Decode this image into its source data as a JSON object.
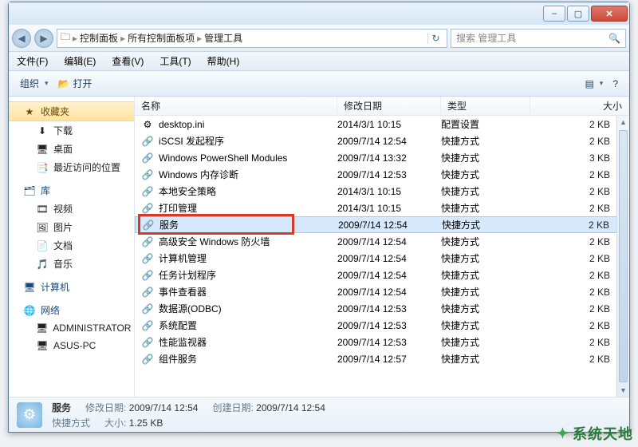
{
  "titlebar": {
    "min": "–",
    "max": "▢",
    "close": "✕"
  },
  "nav": {
    "back": "◀",
    "fwd": "▶",
    "crumbs": [
      "控制面板",
      "所有控制面板项",
      "管理工具"
    ],
    "refresh": "↻",
    "search_placeholder": "搜索 管理工具"
  },
  "menu": [
    "文件(F)",
    "编辑(E)",
    "查看(V)",
    "工具(T)",
    "帮助(H)"
  ],
  "toolbar": {
    "organize": "组织",
    "open": "打开",
    "view_icon": "▤",
    "help_icon": "?"
  },
  "sidebar": {
    "favorites": {
      "label": "收藏夹",
      "icon": "★",
      "items": [
        {
          "icon": "⬇",
          "label": "下载"
        },
        {
          "icon": "🖥",
          "label": "桌面"
        },
        {
          "icon": "📑",
          "label": "最近访问的位置"
        }
      ]
    },
    "libraries": {
      "label": "库",
      "icon": "🗂",
      "items": [
        {
          "icon": "🎞",
          "label": "视频"
        },
        {
          "icon": "🖼",
          "label": "图片"
        },
        {
          "icon": "📄",
          "label": "文档"
        },
        {
          "icon": "🎵",
          "label": "音乐"
        }
      ]
    },
    "computer": {
      "label": "计算机",
      "icon": "🖥",
      "items": []
    },
    "network": {
      "label": "网络",
      "icon": "🌐",
      "items": [
        {
          "icon": "🖥",
          "label": "ADMINISTRATOR"
        },
        {
          "icon": "🖥",
          "label": "ASUS-PC"
        }
      ]
    }
  },
  "columns": {
    "name": "名称",
    "date": "修改日期",
    "type": "类型",
    "size": "大小"
  },
  "files": [
    {
      "icon": "⚙",
      "name": "desktop.ini",
      "date": "2014/3/1 10:15",
      "type": "配置设置",
      "size": "2 KB"
    },
    {
      "icon": "🔗",
      "name": "iSCSI 发起程序",
      "date": "2009/7/14 12:54",
      "type": "快捷方式",
      "size": "2 KB"
    },
    {
      "icon": "🔗",
      "name": "Windows PowerShell Modules",
      "date": "2009/7/14 13:32",
      "type": "快捷方式",
      "size": "3 KB"
    },
    {
      "icon": "🔗",
      "name": "Windows 内存诊断",
      "date": "2009/7/14 12:53",
      "type": "快捷方式",
      "size": "2 KB"
    },
    {
      "icon": "🔗",
      "name": "本地安全策略",
      "date": "2014/3/1 10:15",
      "type": "快捷方式",
      "size": "2 KB"
    },
    {
      "icon": "🔗",
      "name": "打印管理",
      "date": "2014/3/1 10:15",
      "type": "快捷方式",
      "size": "2 KB"
    },
    {
      "icon": "🔗",
      "name": "服务",
      "date": "2009/7/14 12:54",
      "type": "快捷方式",
      "size": "2 KB",
      "selected": true
    },
    {
      "icon": "🔗",
      "name": "高级安全 Windows 防火墙",
      "date": "2009/7/14 12:54",
      "type": "快捷方式",
      "size": "2 KB"
    },
    {
      "icon": "🔗",
      "name": "计算机管理",
      "date": "2009/7/14 12:54",
      "type": "快捷方式",
      "size": "2 KB"
    },
    {
      "icon": "🔗",
      "name": "任务计划程序",
      "date": "2009/7/14 12:54",
      "type": "快捷方式",
      "size": "2 KB"
    },
    {
      "icon": "🔗",
      "name": "事件查看器",
      "date": "2009/7/14 12:54",
      "type": "快捷方式",
      "size": "2 KB"
    },
    {
      "icon": "🔗",
      "name": "数据源(ODBC)",
      "date": "2009/7/14 12:53",
      "type": "快捷方式",
      "size": "2 KB"
    },
    {
      "icon": "🔗",
      "name": "系统配置",
      "date": "2009/7/14 12:53",
      "type": "快捷方式",
      "size": "2 KB"
    },
    {
      "icon": "🔗",
      "name": "性能监视器",
      "date": "2009/7/14 12:53",
      "type": "快捷方式",
      "size": "2 KB"
    },
    {
      "icon": "🔗",
      "name": "组件服务",
      "date": "2009/7/14 12:57",
      "type": "快捷方式",
      "size": "2 KB"
    }
  ],
  "highlight_index": 6,
  "status": {
    "name": "服务",
    "lines": [
      [
        {
          "k": "修改日期:",
          "v": "2009/7/14 12:54"
        },
        {
          "k": "创建日期:",
          "v": "2009/7/14 12:54"
        }
      ],
      [
        {
          "k": "快捷方式",
          "v": ""
        },
        {
          "k": "大小:",
          "v": "1.25 KB"
        }
      ]
    ]
  },
  "watermark": "系统天地"
}
